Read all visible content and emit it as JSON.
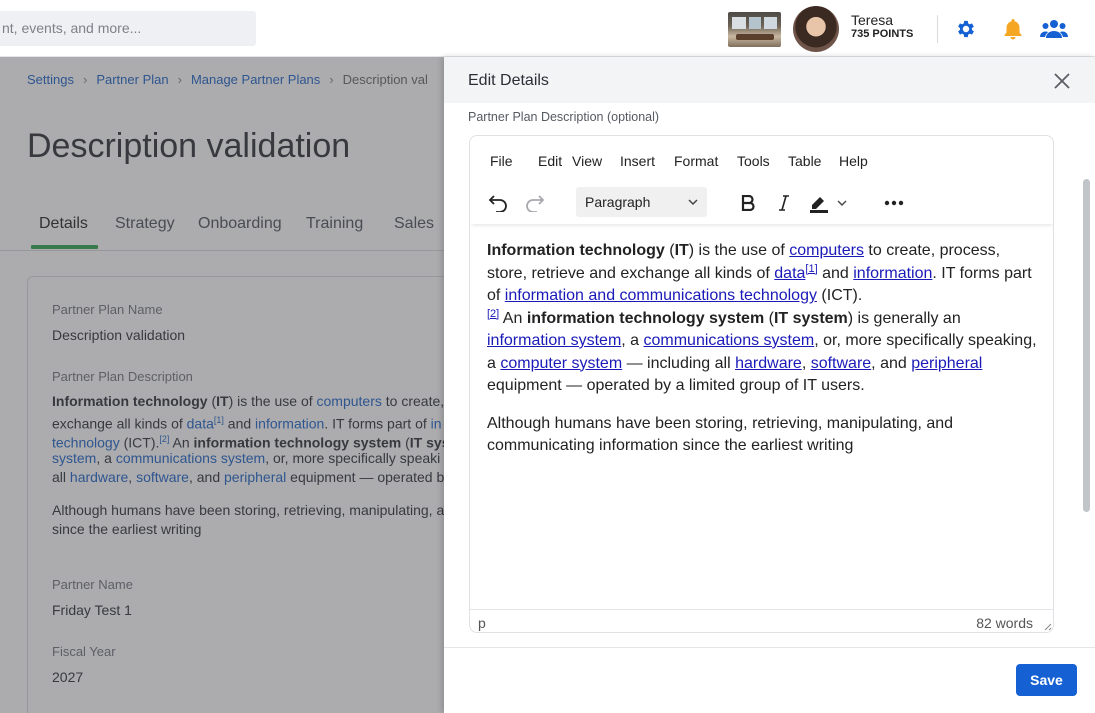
{
  "topbar": {
    "search_placeholder": "nt, events, and more...",
    "user_name": "Teresa",
    "user_points": "735 POINTS"
  },
  "breadcrumb": [
    "Settings",
    "Partner Plan",
    "Manage Partner Plans",
    "Description val"
  ],
  "page": {
    "title": "Description validation",
    "tabs": [
      "Details",
      "Strategy",
      "Onboarding",
      "Training",
      "Sales"
    ],
    "active_tab": "Details",
    "fields": {
      "plan_name_label": "Partner Plan Name",
      "plan_name_value": "Description validation",
      "plan_desc_label": "Partner Plan Description",
      "partner_name_label": "Partner Name",
      "partner_name_value": "Friday Test 1",
      "fiscal_year_label": "Fiscal Year",
      "fiscal_year_value": "2027"
    },
    "desc_lines": [
      {
        "a": "Information technology",
        "b": " (",
        "c": "IT",
        "d": ") is the use of ",
        "e": "computers",
        "f": " to create, p"
      },
      {
        "a": "exchange all kinds of ",
        "b": "data",
        "c": "[1]",
        "d": " and ",
        "e": "information",
        "f": ". IT forms part of ",
        "g": "in"
      },
      {
        "a": "technology",
        "b": " (ICT).",
        "c": "[2]",
        "d": " An ",
        "e": "information technology system",
        "f": " (",
        "g": "IT syste"
      },
      {
        "a": "system",
        "b": ", a ",
        "c": "communications system",
        "d": ", or, more specifically speaki"
      },
      {
        "a": "all ",
        "b": "hardware",
        "c": ", ",
        "d": "software",
        "e": ", and ",
        "f": "peripheral",
        "g": " equipment — operated by"
      },
      {
        "a": "Although humans have been storing, retrieving, manipulating, ar"
      },
      {
        "a": "since the earliest writing"
      }
    ]
  },
  "drawer": {
    "title": "Edit Details",
    "field_label": "Partner Plan Description (optional)",
    "menu": [
      "File",
      "Edit",
      "View",
      "Insert",
      "Format",
      "Tools",
      "Table",
      "Help"
    ],
    "block_format": "Paragraph",
    "content": {
      "p1": {
        "t1": "Information technology",
        "t2": " (",
        "t3": "IT",
        "t4": ") is the use of ",
        "l1": "computers",
        "t5": " to create, process, store, retrieve and exchange all kinds of ",
        "l2": "data",
        "s1": "[1]",
        "t6": " and ",
        "l3": "information",
        "t7": ". IT forms part of ",
        "l4": "information and communications technology",
        "t8": " (ICT).",
        "s2": "[2]",
        "t9": " An ",
        "t10": "information technology system",
        "t11": " (",
        "t12": "IT system",
        "t13": ") is generally an ",
        "l5": "information system",
        "t14": ", a ",
        "l6": "communications system",
        "t15": ", or, more specifically speaking, a ",
        "l7": "computer system",
        "t16": " — including all ",
        "l8": "hardware",
        "t17": ", ",
        "l9": "software",
        "t18": ", and ",
        "l10": "peripheral",
        "t19": " equipment — operated by a limited group of IT users."
      },
      "p2": "Although humans have been storing, retrieving, manipulating, and communicating information since the earliest writing"
    },
    "status_path": "p",
    "word_count": "82 words",
    "save_label": "Save"
  },
  "colors": {
    "accent": "#1561d4",
    "link": "#1a62c7",
    "tab_active": "#2da44e",
    "bell": "#f5a623"
  }
}
